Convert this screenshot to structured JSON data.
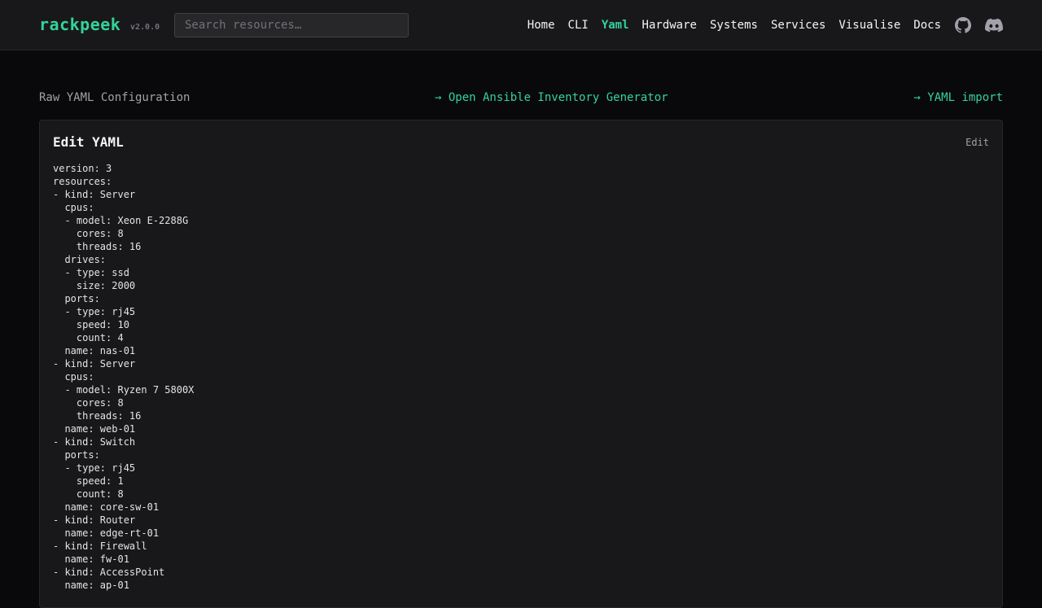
{
  "header": {
    "brand": "rackpeek",
    "version": "v2.0.0",
    "search_placeholder": "Search resources…",
    "nav": {
      "home": "Home",
      "cli": "CLI",
      "yaml": "Yaml",
      "hardware": "Hardware",
      "systems": "Systems",
      "services": "Services",
      "visualise": "Visualise",
      "docs": "Docs"
    },
    "icons": [
      "github-icon",
      "discord-icon"
    ],
    "accent_color": "#34d399"
  },
  "subbar": {
    "title": "Raw YAML Configuration",
    "ansible_link": "→ Open Ansible Inventory Generator",
    "import_link": "→ YAML import"
  },
  "panel": {
    "title": "Edit YAML",
    "edit_label": "Edit",
    "yaml": "version: 3\nresources:\n- kind: Server\n  cpus:\n  - model: Xeon E-2288G\n    cores: 8\n    threads: 16\n  drives:\n  - type: ssd\n    size: 2000\n  ports:\n  - type: rj45\n    speed: 10\n    count: 4\n  name: nas-01\n- kind: Server\n  cpus:\n  - model: Ryzen 7 5800X\n    cores: 8\n    threads: 16\n  name: web-01\n- kind: Switch\n  ports:\n  - type: rj45\n    speed: 1\n    count: 8\n  name: core-sw-01\n- kind: Router\n  name: edge-rt-01\n- kind: Firewall\n  name: fw-01\n- kind: AccessPoint\n  name: ap-01"
  }
}
